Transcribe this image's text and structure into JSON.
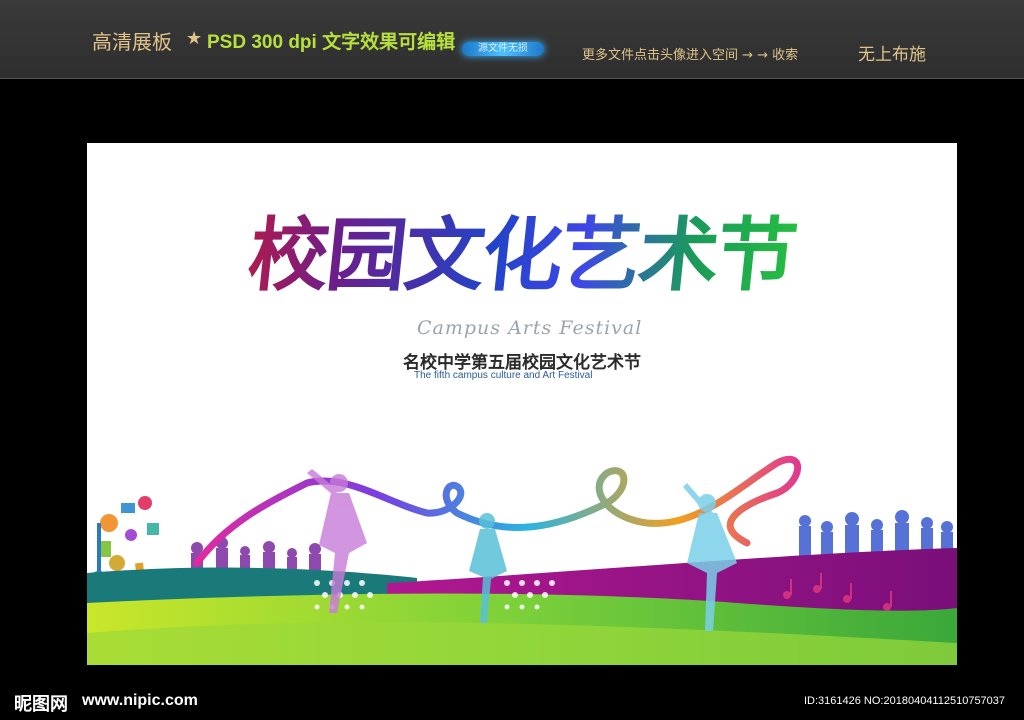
{
  "header": {
    "title": "高清展板",
    "star": "★",
    "specs": "PSD 300 dpi 文字效果可编辑",
    "badge": "源文件无损",
    "more_link": "更多文件点击头像进入空间 → → 收索",
    "brand": "无上布施"
  },
  "poster": {
    "title": "校园文化艺术节",
    "script_title": "Campus Arts Festival",
    "subtitle_cn": "名校中学第五届校园文化艺术节",
    "subtitle_en": "The fifth campus culture and Art Festival",
    "colors": {
      "title_start": "#c51a3a",
      "title_mid": "#2244c8",
      "title_end": "#28c93a",
      "green": "#6bc21e",
      "magenta": "#a0168c",
      "teal": "#1a7a7a"
    }
  },
  "footer": {
    "logo": "昵图网",
    "url": "www.nipic.com",
    "id": "ID:3161426 NO:20180404112510757037"
  }
}
